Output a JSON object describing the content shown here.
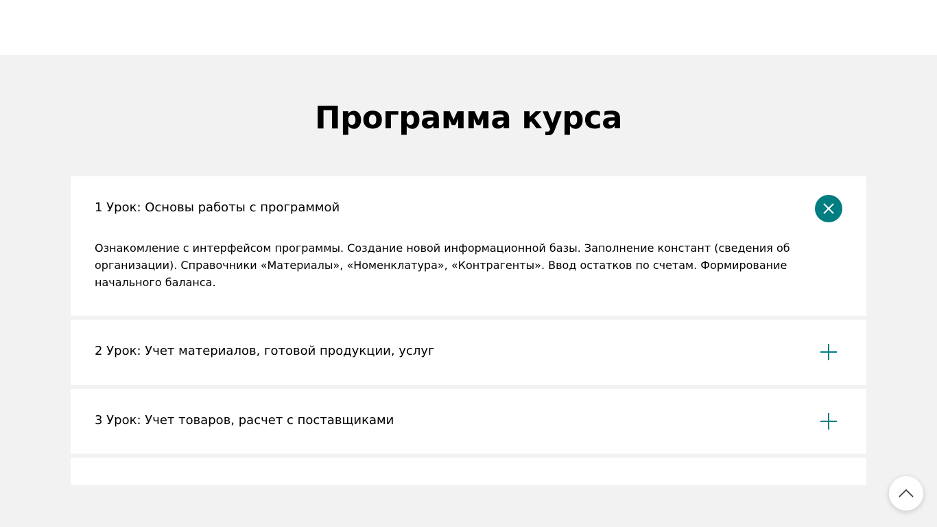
{
  "section": {
    "title": "Программа курса"
  },
  "accordion": {
    "items": [
      {
        "title": "1 Урок: Основы работы с программой",
        "body": "Ознакомление с интерфейсом программы. Создание новой информационной базы. Заполнение констант (сведения об организации). Справочники «Материалы», «Номенклатура», «Контрагенты». Ввод остатков по счетам. Формирование начального баланса.",
        "expanded": true
      },
      {
        "title": "2 Урок: Учет материалов, готовой продукции, услуг",
        "expanded": false
      },
      {
        "title": "3 Урок: Учет товаров, расчет с поставщиками",
        "expanded": false
      }
    ]
  },
  "icons": {
    "close": "close-icon",
    "expand": "plus-icon",
    "scroll_top": "chevron-up-icon"
  },
  "colors": {
    "accent": "#007d80",
    "section_background": "#f2f2f2",
    "card_background": "#ffffff"
  }
}
